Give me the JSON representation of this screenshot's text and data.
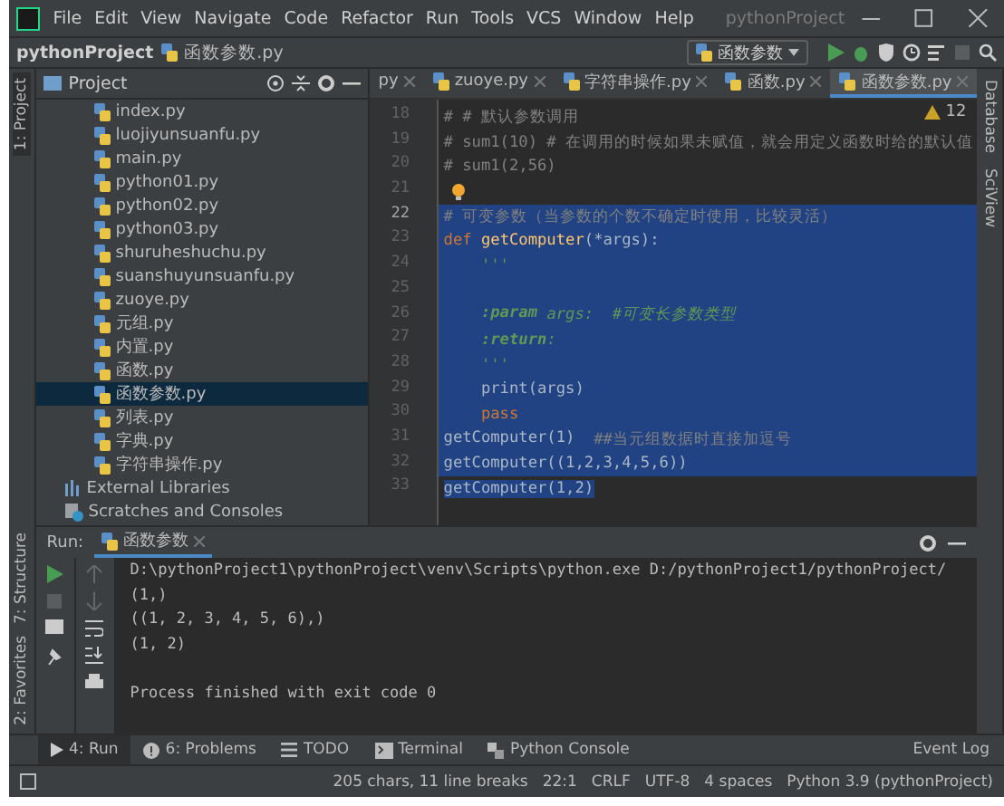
{
  "menu_bar": {
    "items": [
      "File",
      "Edit",
      "View",
      "Navigate",
      "Code",
      "Refactor",
      "Run",
      "Tools",
      "VCS",
      "Window",
      "Help"
    ],
    "title": "pythonProject"
  },
  "nav_bar": {
    "project": "pythonProject",
    "file": "函数参数.py",
    "run_config": "函数参数"
  },
  "left_stripe": {
    "top": "1: Project",
    "bottom": [
      "7: Structure",
      "2: Favorites"
    ]
  },
  "right_stripe": [
    "Database",
    "SciView"
  ],
  "project_panel": {
    "title": "Project",
    "items": [
      {
        "label": "index.py",
        "kind": "file",
        "selected": false
      },
      {
        "label": "luojiyunsuanfu.py",
        "kind": "file",
        "selected": false
      },
      {
        "label": "main.py",
        "kind": "file",
        "selected": false
      },
      {
        "label": "python01.py",
        "kind": "file",
        "selected": false
      },
      {
        "label": "python02.py",
        "kind": "file",
        "selected": false
      },
      {
        "label": "python03.py",
        "kind": "file",
        "selected": false
      },
      {
        "label": "shuruheshuchu.py",
        "kind": "file",
        "selected": false
      },
      {
        "label": "suanshuyunsuanfu.py",
        "kind": "file",
        "selected": false
      },
      {
        "label": "zuoye.py",
        "kind": "file",
        "selected": false
      },
      {
        "label": "元组.py",
        "kind": "file",
        "selected": false
      },
      {
        "label": "内置.py",
        "kind": "file",
        "selected": false
      },
      {
        "label": "函数.py",
        "kind": "file",
        "selected": false
      },
      {
        "label": "函数参数.py",
        "kind": "file",
        "selected": true
      },
      {
        "label": "列表.py",
        "kind": "file",
        "selected": false
      },
      {
        "label": "字典.py",
        "kind": "file",
        "selected": false
      },
      {
        "label": "字符串操作.py",
        "kind": "file",
        "selected": false
      },
      {
        "label": "External Libraries",
        "kind": "library",
        "selected": false
      },
      {
        "label": "Scratches and Consoles",
        "kind": "scratches",
        "selected": false
      }
    ]
  },
  "editor_tabs": [
    {
      "label": "py",
      "selected": false
    },
    {
      "label": "zuoye.py",
      "selected": false
    },
    {
      "label": "字符串操作.py",
      "selected": false
    },
    {
      "label": "函数.py",
      "selected": false
    },
    {
      "label": "函数参数.py",
      "selected": true
    }
  ],
  "inspections": {
    "warnings": "12"
  },
  "code": [
    {
      "number": "18",
      "selected": false,
      "segments": [
        {
          "text": "# # 默认参数调用",
          "kind": "comment"
        }
      ]
    },
    {
      "number": "19",
      "selected": false,
      "segments": [
        {
          "text": "# sum1(10) # 在调用的时候如果未赋值，就会用定义函数时给的默认值",
          "kind": "comment"
        }
      ]
    },
    {
      "number": "20",
      "selected": false,
      "segments": [
        {
          "text": "# sum1(2,56)",
          "kind": "comment"
        }
      ]
    },
    {
      "number": "21",
      "selected": false,
      "bulb": true
    },
    {
      "number": "22",
      "selected": true,
      "segments": [
        {
          "text": "# 可变参数（当参数的个数不确定时使用，比较灵活）",
          "kind": "comment"
        }
      ]
    },
    {
      "number": "23",
      "selected": true,
      "segments": [
        {
          "text": "def ",
          "kind": "keyword"
        },
        {
          "text": "getComputer",
          "kind": "func"
        },
        {
          "text": "(*args):",
          "kind": "plain"
        }
      ]
    },
    {
      "number": "24",
      "selected": true,
      "segments": [
        {
          "text": "    '''",
          "kind": "doc"
        }
      ]
    },
    {
      "number": "25",
      "selected": true
    },
    {
      "number": "26",
      "selected": true,
      "segments": [
        {
          "text": "    :param",
          "kind": "doctag"
        },
        {
          "text": " args:  #可变长参数类型",
          "kind": "doc"
        }
      ]
    },
    {
      "number": "27",
      "selected": true,
      "segments": [
        {
          "text": "    :return",
          "kind": "doctag"
        },
        {
          "text": ":",
          "kind": "doc"
        }
      ]
    },
    {
      "number": "28",
      "selected": true,
      "segments": [
        {
          "text": "    '''",
          "kind": "doc"
        }
      ]
    },
    {
      "number": "29",
      "selected": true,
      "segments": [
        {
          "text": "    print(args)",
          "kind": "plain"
        }
      ]
    },
    {
      "number": "30",
      "selected": true,
      "segments": [
        {
          "text": "    pass",
          "kind": "keyword"
        }
      ]
    },
    {
      "number": "31",
      "selected": true,
      "segments": [
        {
          "text": "getComputer(1)  ",
          "kind": "plain"
        },
        {
          "text": "##当元组数据时直接加逗号",
          "kind": "comment"
        }
      ]
    },
    {
      "number": "32",
      "selected": true,
      "segments": [
        {
          "text": "getComputer((1,2,3,4,5,6))",
          "kind": "plain"
        }
      ]
    },
    {
      "number": "33",
      "selected": true,
      "partial": true,
      "segments": [
        {
          "text": "getComputer(1,2)",
          "kind": "plain"
        }
      ]
    }
  ],
  "run_panel": {
    "label": "Run:",
    "tab": "函数参数",
    "output": [
      {
        "text": "D:\\pythonProject1\\pythonProject\\venv\\Scripts\\python.exe D:/pythonProject1/pythonProject/"
      },
      {
        "text": "(1,)"
      },
      {
        "text": "((1, 2, 3, 4, 5, 6),)"
      },
      {
        "text": "(1, 2)"
      },
      {
        "text": "Process finished with exit code 0",
        "gap_before": true
      }
    ]
  },
  "tool_tabs": [
    {
      "label": "4: Run",
      "selected": true
    },
    {
      "label": "6: Problems",
      "selected": false
    },
    {
      "label": "TODO",
      "selected": false
    },
    {
      "label": "Terminal",
      "selected": false
    },
    {
      "label": "Python Console",
      "selected": false
    }
  ],
  "event_log": "Event Log",
  "status_bar": [
    "205 chars, 11 line breaks",
    "22:1",
    "CRLF",
    "UTF-8",
    "4 spaces",
    "Python 3.9 (pythonProject)"
  ]
}
